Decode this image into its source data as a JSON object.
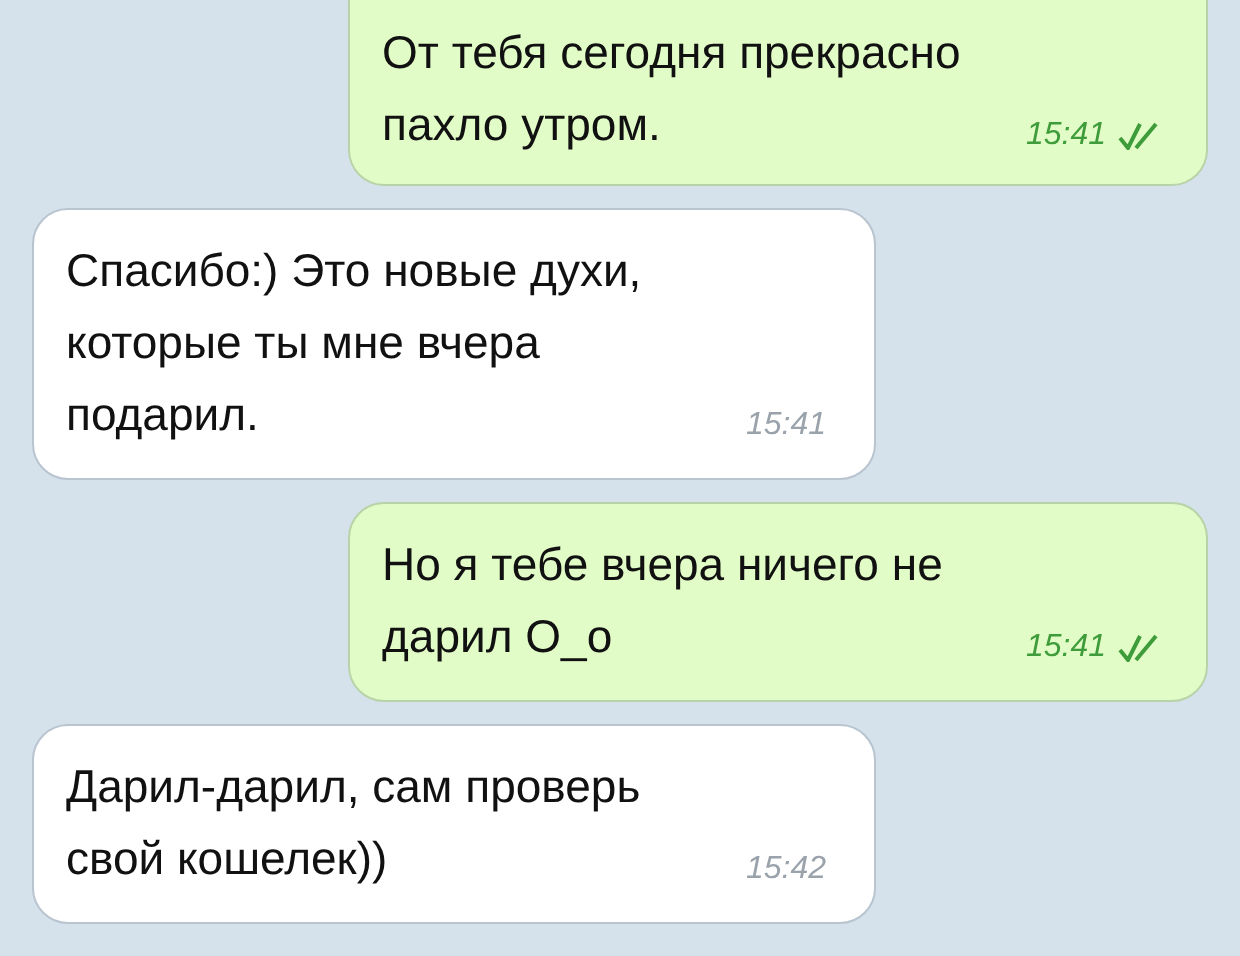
{
  "messages": [
    {
      "kind": "outgoing",
      "text": "От тебя сегодня прекрасно пахло утром.",
      "time": "15:41",
      "read": true
    },
    {
      "kind": "incoming",
      "text": "Спасибо:) Это новые духи, которые ты мне вчера подарил.",
      "time": "15:41"
    },
    {
      "kind": "outgoing",
      "text": "Но я тебе вчера ничего не дарил О_о",
      "time": "15:41",
      "read": true
    },
    {
      "kind": "incoming",
      "text": "Дарил-дарил, сам проверь свой кошелек))",
      "time": "15:42"
    }
  ]
}
